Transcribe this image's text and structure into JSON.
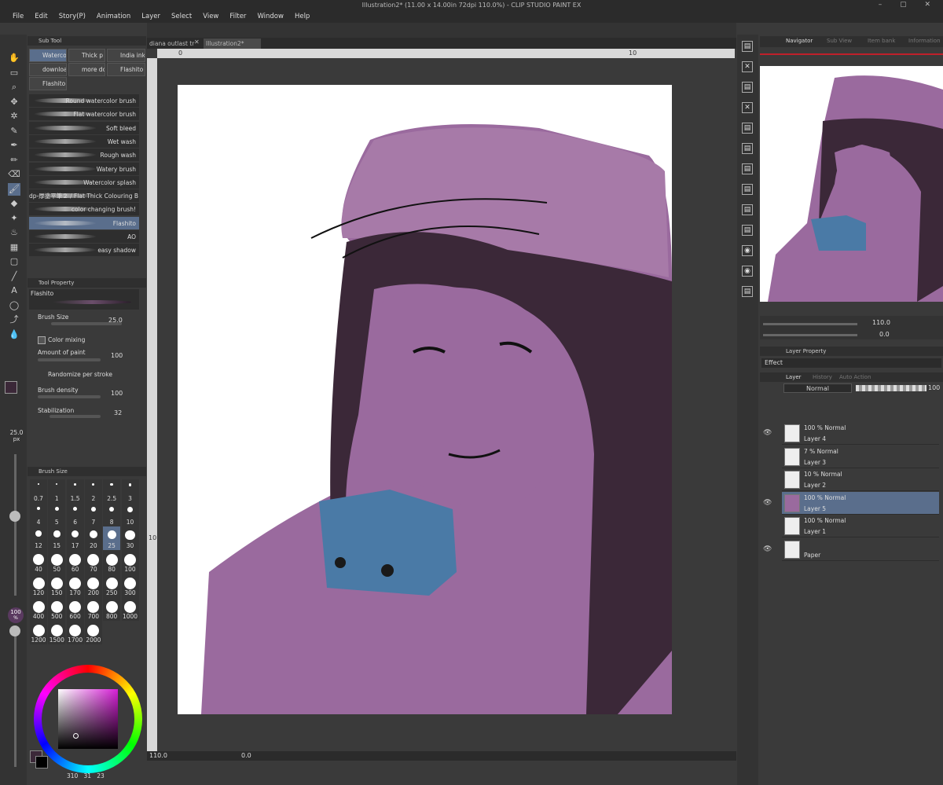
{
  "window": {
    "title": "Illustration2* (11.00 x 14.00in 72dpi 110.0%) - CLIP STUDIO PAINT EX"
  },
  "menu": [
    "File",
    "Edit",
    "Story(P)",
    "Animation",
    "Layer",
    "Select",
    "View",
    "Filter",
    "Window",
    "Help"
  ],
  "subtool": {
    "header": "Sub Tool",
    "tabs": [
      "Waterco",
      "Thick p",
      "India ink",
      "downloa",
      "more do",
      "Flashito",
      "Flashito"
    ],
    "brushes": [
      "Round watercolor brush",
      "Flat watercolor brush",
      "Soft bleed",
      "Wet wash",
      "Rough wash",
      "Watery brush",
      "Watercolor splash",
      "dp-厚塗平筆２ / Flat Thick Colouring B",
      "color changing brush!",
      "Flashito",
      "AO",
      "easy shadow"
    ],
    "selected_index": 9
  },
  "toolprop": {
    "header": "Tool Property",
    "name": "Flashito",
    "brush_size_label": "Brush Size",
    "brush_size": "25.0",
    "color_mixing": "Color mixing",
    "amount_label": "Amount of paint",
    "amount": "100",
    "randomize": "Randomize per stroke",
    "density_label": "Brush density",
    "density": "100",
    "stab_label": "Stabilization",
    "stab": "32"
  },
  "left_strip": {
    "size": "25.0",
    "unit": "px",
    "opacity": "100",
    "opacity_unit": "%"
  },
  "brushsize_panel": {
    "header": "Brush Size",
    "sizes": [
      "0.7",
      "1",
      "1.5",
      "2",
      "2.5",
      "3",
      "4",
      "5",
      "6",
      "7",
      "8",
      "10",
      "12",
      "15",
      "17",
      "20",
      "25",
      "30",
      "40",
      "50",
      "60",
      "70",
      "80",
      "100",
      "120",
      "150",
      "170",
      "200",
      "250",
      "300",
      "400",
      "500",
      "600",
      "700",
      "800",
      "1000",
      "1200",
      "1500",
      "1700",
      "2000"
    ],
    "selected": "25"
  },
  "color_status": {
    "h": "310",
    "s": "31",
    "v": "23"
  },
  "doc_tabs": [
    "diana outlast tr",
    "Illustration2*"
  ],
  "ruler": {
    "h0": "0",
    "h10": "10",
    "v10": "10"
  },
  "canvas_status": {
    "zoom": "110.0",
    "angle": "0.0"
  },
  "navigator": {
    "tabs": [
      "Navigator",
      "Sub View",
      "Item bank",
      "Information"
    ],
    "zoom": "110.0",
    "angle": "0.0"
  },
  "layer_property": {
    "tab": "Layer Property",
    "effect": "Effect"
  },
  "layers_panel": {
    "tabs": [
      "Layer",
      "History",
      "Auto Action"
    ],
    "blend": "Normal",
    "opacity": "100",
    "layers": [
      {
        "mode": "100 % Normal",
        "name": "Layer 4",
        "visible": true,
        "selected": false
      },
      {
        "mode": "7 % Normal",
        "name": "Layer 3",
        "visible": false,
        "selected": false
      },
      {
        "mode": "10 % Normal",
        "name": "Layer 2",
        "visible": false,
        "selected": false
      },
      {
        "mode": "100 % Normal",
        "name": "Layer 5",
        "visible": true,
        "selected": true
      },
      {
        "mode": "100 % Normal",
        "name": "Layer 1",
        "visible": false,
        "selected": false
      },
      {
        "mode": "",
        "name": "Paper",
        "visible": true,
        "selected": false
      }
    ]
  },
  "colors": {
    "accent": "#5a6e8c",
    "purple": "#9a6a9e",
    "dark": "#3b2838",
    "blue": "#4a7aa6"
  }
}
